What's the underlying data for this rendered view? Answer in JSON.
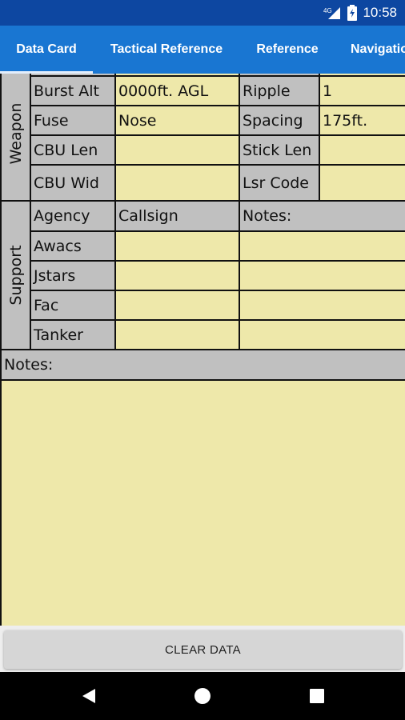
{
  "status_bar": {
    "time": "10:58",
    "network_label": "4G",
    "icons": [
      "signal-icon",
      "battery-icon"
    ]
  },
  "tabs": [
    {
      "label": "Data Card",
      "selected": true
    },
    {
      "label": "Tactical Reference",
      "selected": false
    },
    {
      "label": "Reference",
      "selected": false
    },
    {
      "label": "Navigatio",
      "selected": false
    }
  ],
  "weapon": {
    "section_label": "Weapon",
    "burst_alt_label": "Burst Alt",
    "burst_alt_value": "0000ft. AGL",
    "ripple_label": "Ripple",
    "ripple_value": "1",
    "fuse_label": "Fuse",
    "fuse_value": "Nose",
    "spacing_label": "Spacing",
    "spacing_value": "175ft.",
    "cbu_len_label": "CBU Len",
    "cbu_len_value": "",
    "stick_len_label": "Stick Len",
    "stick_len_value": "",
    "cbu_wid_label": "CBU Wid",
    "cbu_wid_value": "",
    "lsr_code_label": "Lsr Code",
    "lsr_code_value": ""
  },
  "support": {
    "section_label": "Support",
    "header_agency": "Agency",
    "header_callsign": "Callsign",
    "header_notes": "Notes:",
    "rows": [
      {
        "agency": "Awacs",
        "callsign": "",
        "notes": ""
      },
      {
        "agency": "Jstars",
        "callsign": "",
        "notes": ""
      },
      {
        "agency": "Fac",
        "callsign": "",
        "notes": ""
      },
      {
        "agency": "Tanker",
        "callsign": "",
        "notes": ""
      }
    ]
  },
  "notes": {
    "label": "Notes:",
    "value": ""
  },
  "clear_button": "CLEAR DATA",
  "colors": {
    "status_bar": "#0d47a1",
    "tab_bar": "#1976d2",
    "label_cell": "#c0c0c0",
    "field_cell": "#eee8aa",
    "border": "#111111"
  }
}
